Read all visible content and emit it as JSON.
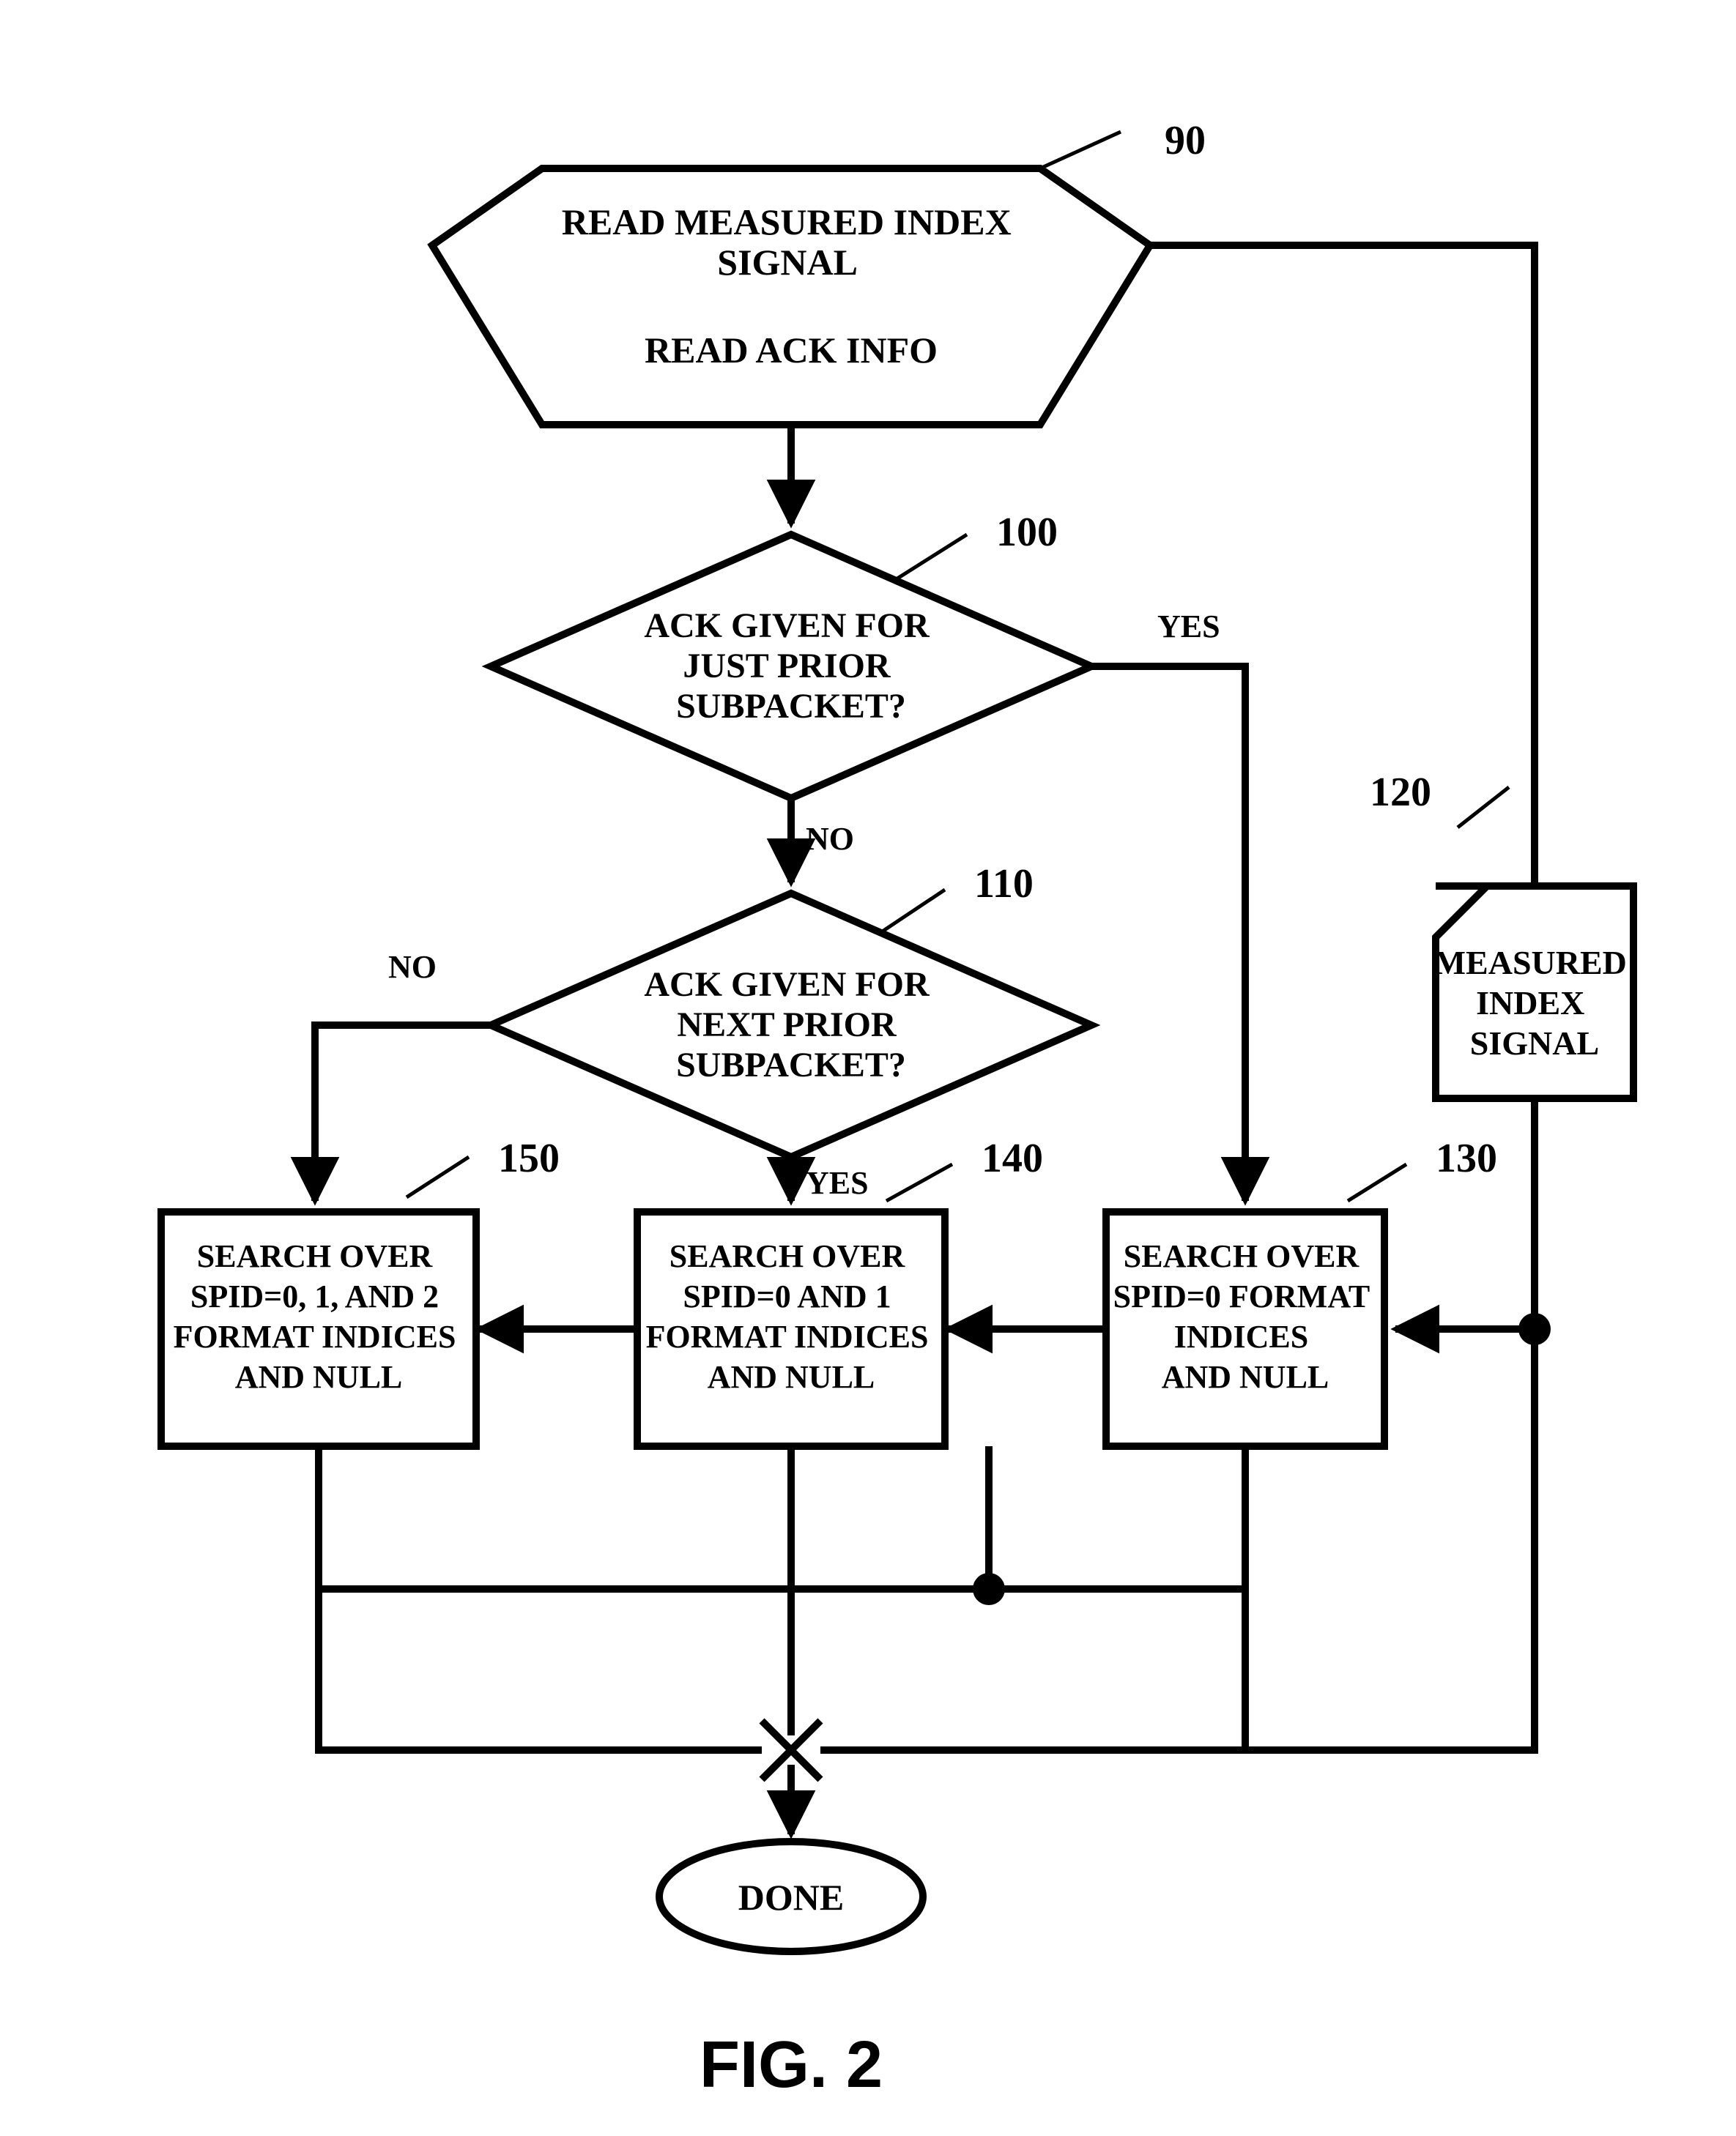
{
  "figure_label": "FIG. 2",
  "labels": {
    "n90": "90",
    "n100": "100",
    "n110": "110",
    "n120": "120",
    "n130": "130",
    "n140": "140",
    "n150": "150"
  },
  "branches": {
    "yes_100": "YES",
    "no_100": "NO",
    "yes_110": "YES",
    "no_110": "NO"
  },
  "nodes": {
    "start_l1": "READ MEASURED INDEX",
    "start_l2": "SIGNAL",
    "start_l3": "READ ACK INFO",
    "d100_l1": "ACK GIVEN FOR",
    "d100_l2": "JUST PRIOR",
    "d100_l3": "SUBPACKET?",
    "d110_l1": "ACK GIVEN FOR",
    "d110_l2": "NEXT PRIOR",
    "d110_l3": "SUBPACKET?",
    "sig_l1": "MEASURED",
    "sig_l2": "INDEX",
    "sig_l3": "SIGNAL",
    "b130_l1": "SEARCH OVER",
    "b130_l2": "SPID=0 FORMAT",
    "b130_l3": "INDICES",
    "b130_l4": "AND NULL",
    "b140_l1": "SEARCH OVER",
    "b140_l2": "SPID=0 AND 1",
    "b140_l3": "FORMAT INDICES",
    "b140_l4": "AND NULL",
    "b150_l1": "SEARCH OVER",
    "b150_l2": "SPID=0, 1, AND 2",
    "b150_l3": "FORMAT INDICES",
    "b150_l4": "AND NULL",
    "done": "DONE"
  }
}
